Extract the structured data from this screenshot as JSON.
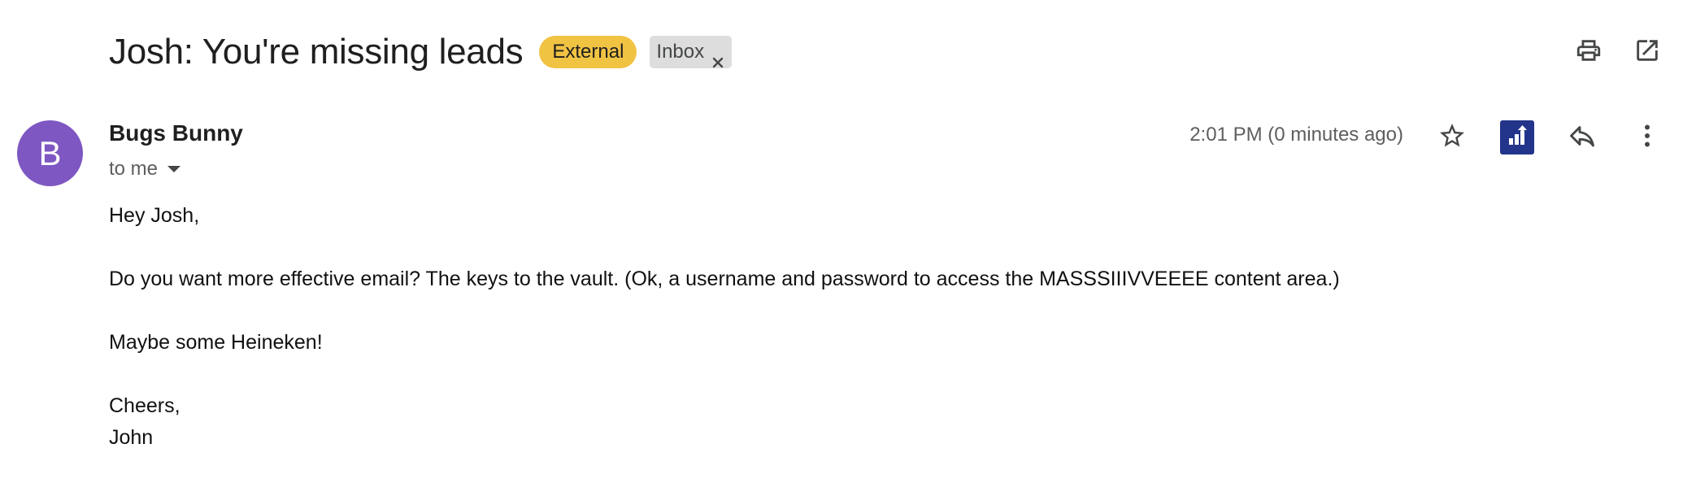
{
  "email": {
    "subject": "Josh: You're missing leads",
    "labels": {
      "external": "External",
      "inbox": "Inbox"
    },
    "sender": {
      "name": "Bugs Bunny",
      "avatar_initial": "B",
      "avatar_color": "#7e57c2"
    },
    "recipient": "to me",
    "timestamp": "2:01 PM (0 minutes ago)",
    "body": {
      "greeting": "Hey Josh,",
      "paragraph1": "Do you want more effective email? The keys to the vault. (Ok, a username and password to access the MASSSIIIVVEEEE content area.)",
      "paragraph2": "Maybe some Heineken!",
      "closing": "Cheers,",
      "signature": "John"
    }
  },
  "icons": {
    "print": "print-icon",
    "open_new_window": "open-in-new-icon",
    "star": "star-icon",
    "addon": "chart-addon-icon",
    "reply": "reply-icon",
    "more": "more-vert-icon",
    "remove_label": "close-icon"
  },
  "colors": {
    "external_chip": "#f1c343",
    "inbox_chip": "#dddddd",
    "addon_brand": "#23358a"
  }
}
